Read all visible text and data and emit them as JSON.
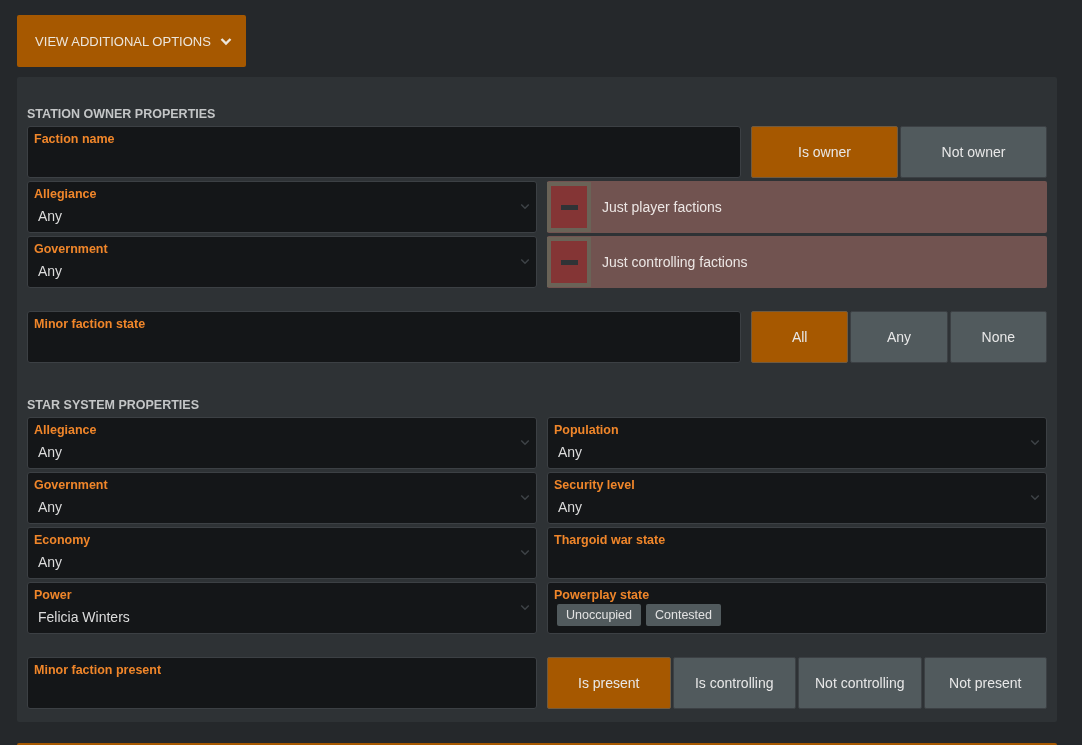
{
  "options_button": {
    "label": "VIEW ADDITIONAL OPTIONS",
    "expanded": false
  },
  "sections": [
    {
      "title": "STATION OWNER PROPERTIES",
      "groups": [
        {
          "rows": [
            {
              "kind": "wide",
              "items": [
                {
                  "kind": "text",
                  "label": "Faction name"
                },
                {
                  "kind": "segmented",
                  "options": [
                    {
                      "label": "Is owner",
                      "selected": true
                    },
                    {
                      "label": "Not owner",
                      "selected": false
                    }
                  ]
                }
              ]
            },
            {
              "kind": "half",
              "items": [
                {
                  "kind": "select",
                  "label": "Allegiance",
                  "value": "Any"
                },
                {
                  "kind": "toggle",
                  "label": "Just player factions",
                  "excluded": true
                }
              ]
            },
            {
              "kind": "half",
              "items": [
                {
                  "kind": "select",
                  "label": "Government",
                  "value": "Any"
                },
                {
                  "kind": "toggle",
                  "label": "Just controlling factions",
                  "excluded": true
                }
              ]
            }
          ]
        },
        {
          "rows": [
            {
              "kind": "wide",
              "items": [
                {
                  "kind": "text",
                  "label": "Minor faction state"
                },
                {
                  "kind": "segmented",
                  "options": [
                    {
                      "label": "All",
                      "selected": true
                    },
                    {
                      "label": "Any",
                      "selected": false
                    },
                    {
                      "label": "None",
                      "selected": false
                    }
                  ]
                }
              ]
            }
          ]
        }
      ]
    },
    {
      "title": "STAR SYSTEM PROPERTIES",
      "groups": [
        {
          "rows": [
            {
              "kind": "half",
              "items": [
                {
                  "kind": "select",
                  "label": "Allegiance",
                  "value": "Any"
                },
                {
                  "kind": "select",
                  "label": "Population",
                  "value": "Any"
                }
              ]
            },
            {
              "kind": "half",
              "items": [
                {
                  "kind": "select",
                  "label": "Government",
                  "value": "Any"
                },
                {
                  "kind": "select",
                  "label": "Security level",
                  "value": "Any"
                }
              ]
            },
            {
              "kind": "half",
              "items": [
                {
                  "kind": "select",
                  "label": "Economy",
                  "value": "Any"
                },
                {
                  "kind": "text",
                  "label": "Thargoid war state"
                }
              ]
            },
            {
              "kind": "half",
              "items": [
                {
                  "kind": "select",
                  "label": "Power",
                  "value": "Felicia Winters"
                },
                {
                  "kind": "tags",
                  "label": "Powerplay state",
                  "tags": [
                    "Unoccupied",
                    "Contested"
                  ]
                }
              ]
            }
          ]
        },
        {
          "rows": [
            {
              "kind": "half",
              "items": [
                {
                  "kind": "text",
                  "label": "Minor faction present"
                },
                {
                  "kind": "segmented",
                  "options": [
                    {
                      "label": "Is present",
                      "selected": true
                    },
                    {
                      "label": "Is controlling",
                      "selected": false
                    },
                    {
                      "label": "Not controlling",
                      "selected": false
                    },
                    {
                      "label": "Not present",
                      "selected": false
                    }
                  ]
                }
              ]
            }
          ]
        }
      ]
    }
  ]
}
